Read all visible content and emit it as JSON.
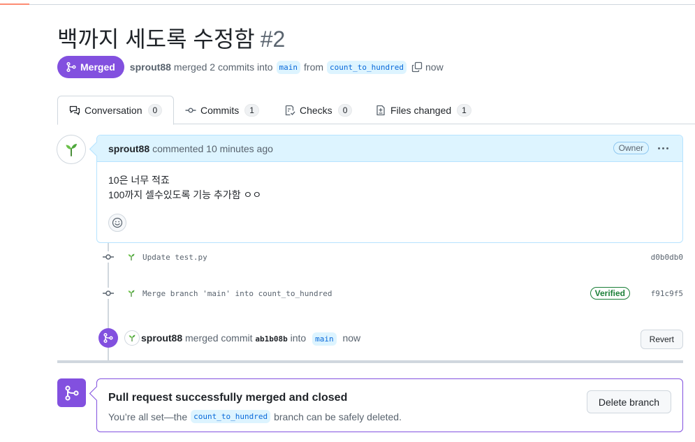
{
  "pr": {
    "title": "백까지 세도록 수정함",
    "number": "#2",
    "state_label": "Merged",
    "author": "sprout88",
    "merge_summary": "merged 2 commits into",
    "base_branch": "main",
    "from_label": "from",
    "head_branch": "count_to_hundred",
    "time": "now"
  },
  "tabs": [
    {
      "label": "Conversation",
      "count": "0"
    },
    {
      "label": "Commits",
      "count": "1"
    },
    {
      "label": "Checks",
      "count": "0"
    },
    {
      "label": "Files changed",
      "count": "1"
    }
  ],
  "comment": {
    "author": "sprout88",
    "action": "commented 10 minutes ago",
    "badge": "Owner",
    "lines": [
      "10은 너무 적죠",
      "100까지 셀수있도록 기능 추가함 ㅇㅇ"
    ]
  },
  "commits": [
    {
      "message": "Update test.py",
      "sha": "d0b0db0",
      "verified": ""
    },
    {
      "message": "Merge branch 'main' into count_to_hundred",
      "sha": "f91c9f5",
      "verified": "Verified"
    }
  ],
  "merge_event": {
    "author": "sprout88",
    "text1": "merged commit",
    "sha": "ab1b08b",
    "text2": "into",
    "branch": "main",
    "time": "now",
    "revert_label": "Revert"
  },
  "merge_status": {
    "heading": "Pull request successfully merged and closed",
    "text_before": "You’re all set—the",
    "branch": "count_to_hundred",
    "text_after": "branch can be safely deleted.",
    "delete_label": "Delete branch"
  },
  "colors": {
    "merged": "#8250df",
    "link": "#0969da",
    "verified": "#1a7f37",
    "tab_accent": "#fd8c73"
  }
}
